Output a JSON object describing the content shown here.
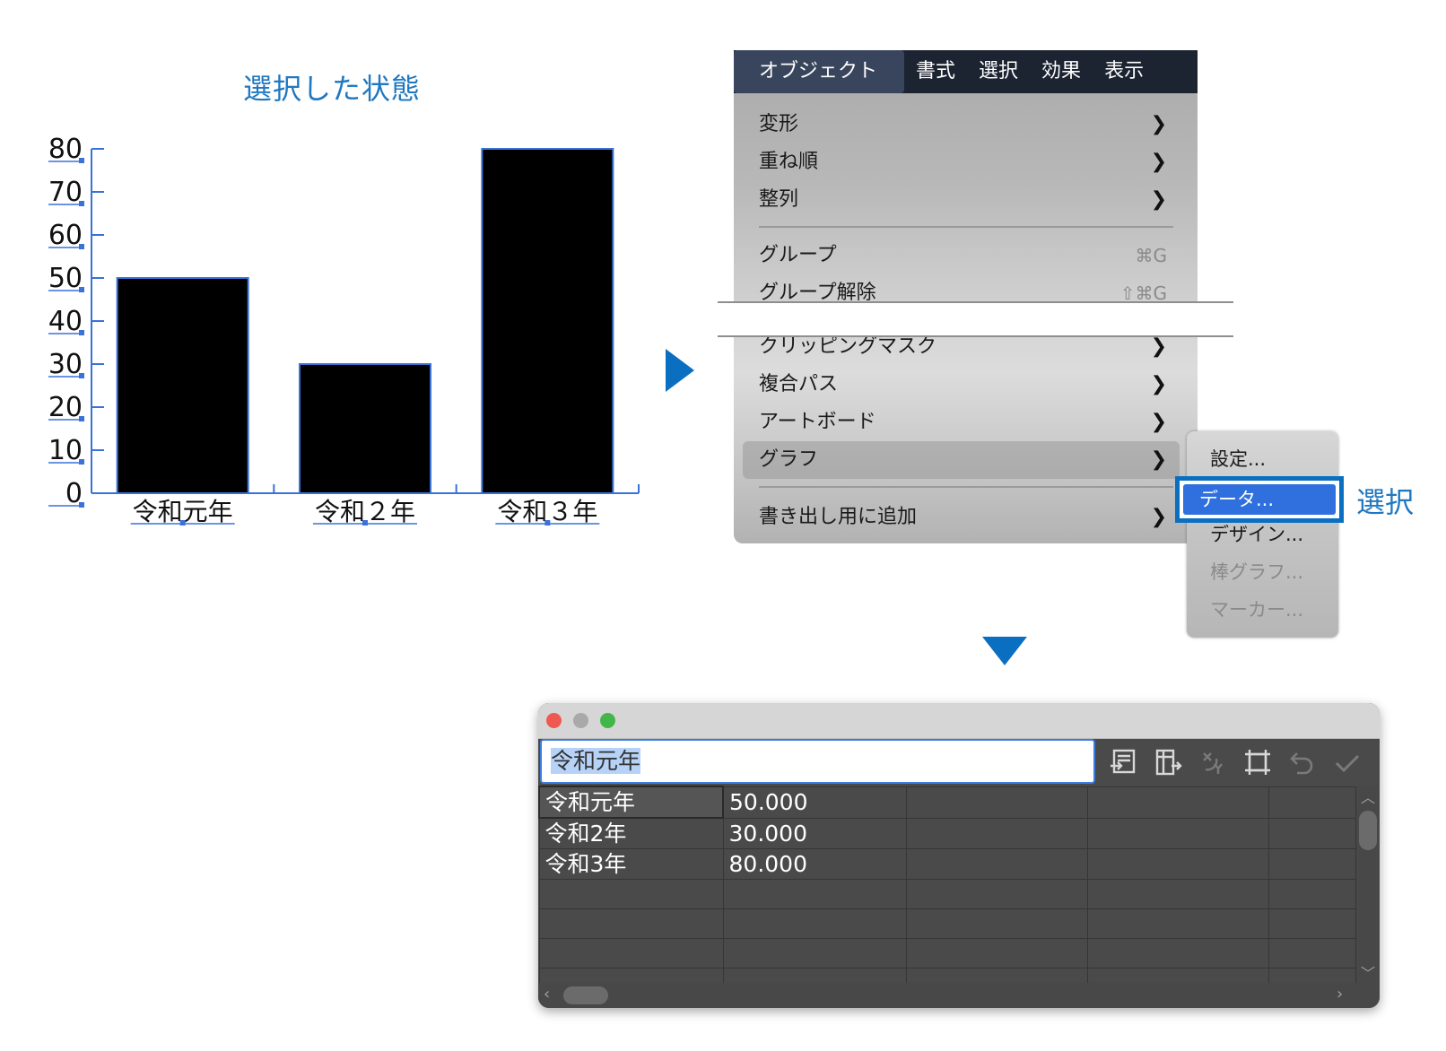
{
  "chart_title": "選択した状態",
  "chart_data": {
    "type": "bar",
    "categories": [
      "令和元年",
      "令和２年",
      "令和３年"
    ],
    "values": [
      50,
      30,
      80
    ],
    "ylim": [
      0,
      80
    ],
    "yticks": [
      0,
      10,
      20,
      30,
      40,
      50,
      60,
      70,
      80
    ],
    "ytick_labels": [
      "0",
      "10",
      "20",
      "30",
      "40",
      "50",
      "60",
      "70",
      "80"
    ],
    "bar_color": "#000000",
    "selection_color": "#3a72d8",
    "grid": false
  },
  "menubar": {
    "items": [
      "オブジェクト",
      "書式",
      "選択",
      "効果",
      "表示"
    ],
    "active_index": 0
  },
  "object_menu": {
    "items": [
      {
        "label": "変形",
        "submenu": true
      },
      {
        "label": "重ね順",
        "submenu": true
      },
      {
        "label": "整列",
        "submenu": true
      },
      {
        "label": "グループ",
        "shortcut": "⌘G"
      },
      {
        "label": "グループ解除",
        "shortcut": "⇧⌘G"
      },
      {
        "label": "クリッピングマスク",
        "submenu": true
      },
      {
        "label": "複合パス",
        "submenu": true
      },
      {
        "label": "アートボード",
        "submenu": true
      },
      {
        "label": "グラフ",
        "submenu": true,
        "highlighted": true
      },
      {
        "label": "書き出し用に追加",
        "submenu": true
      }
    ]
  },
  "graph_submenu": {
    "items": [
      {
        "label": "設定...",
        "enabled": true
      },
      {
        "label": "データ...",
        "enabled": true,
        "selected": true
      },
      {
        "label": "デザイン...",
        "enabled": true
      },
      {
        "label": "棒グラフ...",
        "enabled": false
      },
      {
        "label": "マーカー...",
        "enabled": false
      }
    ]
  },
  "callout": "選択",
  "data_window": {
    "input_value": "令和元年",
    "rows": [
      [
        "令和元年",
        "50.000",
        "",
        "",
        ""
      ],
      [
        "令和2年",
        "30.000",
        "",
        "",
        ""
      ],
      [
        "令和3年",
        "80.000",
        "",
        "",
        ""
      ],
      [
        "",
        "",
        "",
        "",
        ""
      ],
      [
        "",
        "",
        "",
        "",
        ""
      ],
      [
        "",
        "",
        "",
        "",
        ""
      ],
      [
        "",
        "",
        "",
        "",
        ""
      ]
    ],
    "toolbar_icons": [
      {
        "name": "import-data-icon",
        "enabled": true
      },
      {
        "name": "transpose-icon",
        "enabled": true
      },
      {
        "name": "switch-xy-icon",
        "enabled": false
      },
      {
        "name": "cell-style-icon",
        "enabled": true
      },
      {
        "name": "revert-icon",
        "enabled": false
      },
      {
        "name": "apply-icon",
        "enabled": false
      }
    ]
  },
  "colors": {
    "accent": "#0b6fc1",
    "menu_selected": "#2f70de",
    "menubar_bg": "#1c2331",
    "window_bg": "#4a4a4a"
  }
}
